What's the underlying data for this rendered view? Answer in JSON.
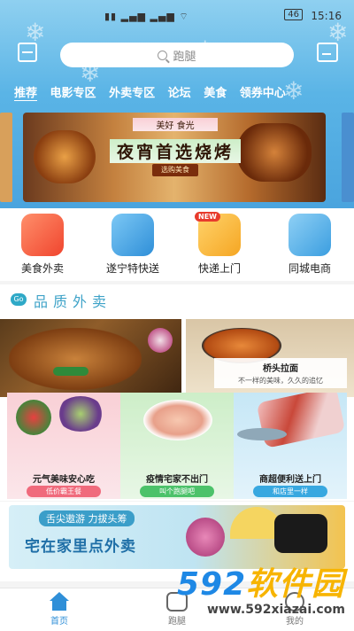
{
  "status_bar": {
    "time": "15:16",
    "battery": "46"
  },
  "search": {
    "placeholder": "跑腿"
  },
  "category_tabs": [
    "推荐",
    "电影专区",
    "外卖专区",
    "论坛",
    "美食",
    "领券中心"
  ],
  "banner": {
    "brand": "美好 食光",
    "headline": "夜宵首选烧烤",
    "cta": "选购美食"
  },
  "services": [
    {
      "label": "美食外卖",
      "badge": ""
    },
    {
      "label": "遂宁特快送",
      "badge": ""
    },
    {
      "label": "快递上门",
      "badge": "NEW"
    },
    {
      "label": "同城电商",
      "badge": ""
    }
  ],
  "section": {
    "icon_text": "Go",
    "title": "品质外卖"
  },
  "feature": {
    "title": "桥头拉面",
    "subtitle": "不一样的美味，久久的追忆"
  },
  "tiles": [
    {
      "caption": "元气美味安心吃",
      "button": "低价霸王餐"
    },
    {
      "caption": "疫情宅家不出门",
      "button": "叫个跑腿吧"
    },
    {
      "caption": "商超便利送上门",
      "button": "和店里一样"
    }
  ],
  "promo": {
    "tag": "舌尖遨游 力拔头筹",
    "headline": "宅在家里点外卖"
  },
  "tabbar": [
    {
      "label": "首页",
      "icon": "home-icon"
    },
    {
      "label": "跑腿",
      "icon": "scooter-icon"
    },
    {
      "label": "我的",
      "icon": "person-icon"
    }
  ],
  "watermark": {
    "brand_num": "592",
    "brand_text": "软件园",
    "url": "www.592xiazai.com"
  },
  "colors": {
    "accent": "#2f8fd8",
    "header_blue": "#5ab4e6",
    "section_title": "#3fa3c8"
  }
}
